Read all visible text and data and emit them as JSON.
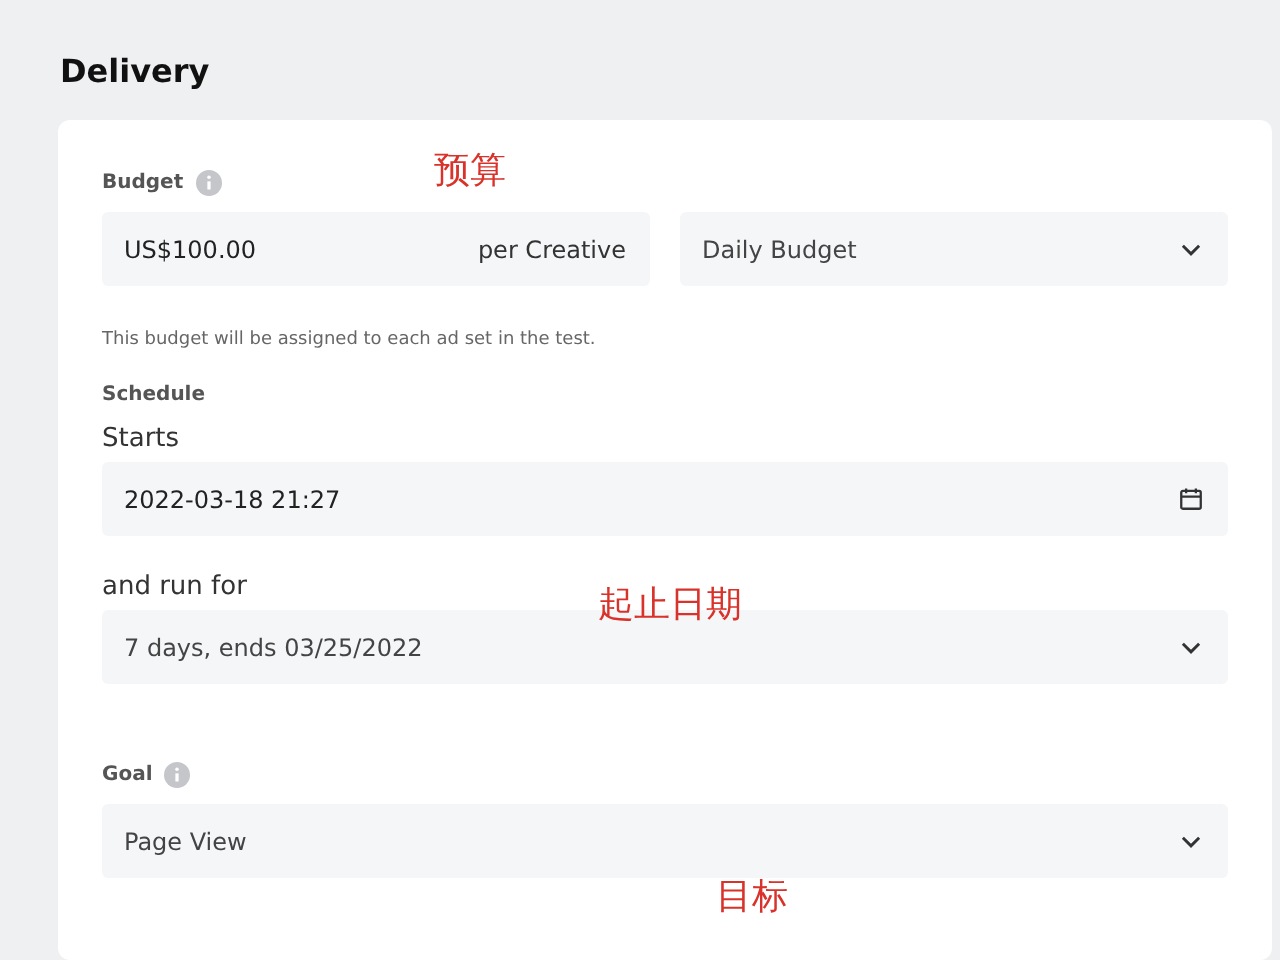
{
  "section_title": "Delivery",
  "budget": {
    "label": "Budget",
    "annotation": "预算",
    "amount": "US$100.00",
    "unit": "per Creative",
    "type": "Daily Budget",
    "hint": "This budget will be assigned to each ad set in the test."
  },
  "schedule": {
    "label": "Schedule",
    "starts_label": "Starts",
    "starts": "2022-03-18 21:27",
    "run_label": "and run for",
    "annotation": "起止日期",
    "duration": "7 days, ends 03/25/2022"
  },
  "goal": {
    "label": "Goal",
    "value": "Page View",
    "annotation": "目标"
  }
}
